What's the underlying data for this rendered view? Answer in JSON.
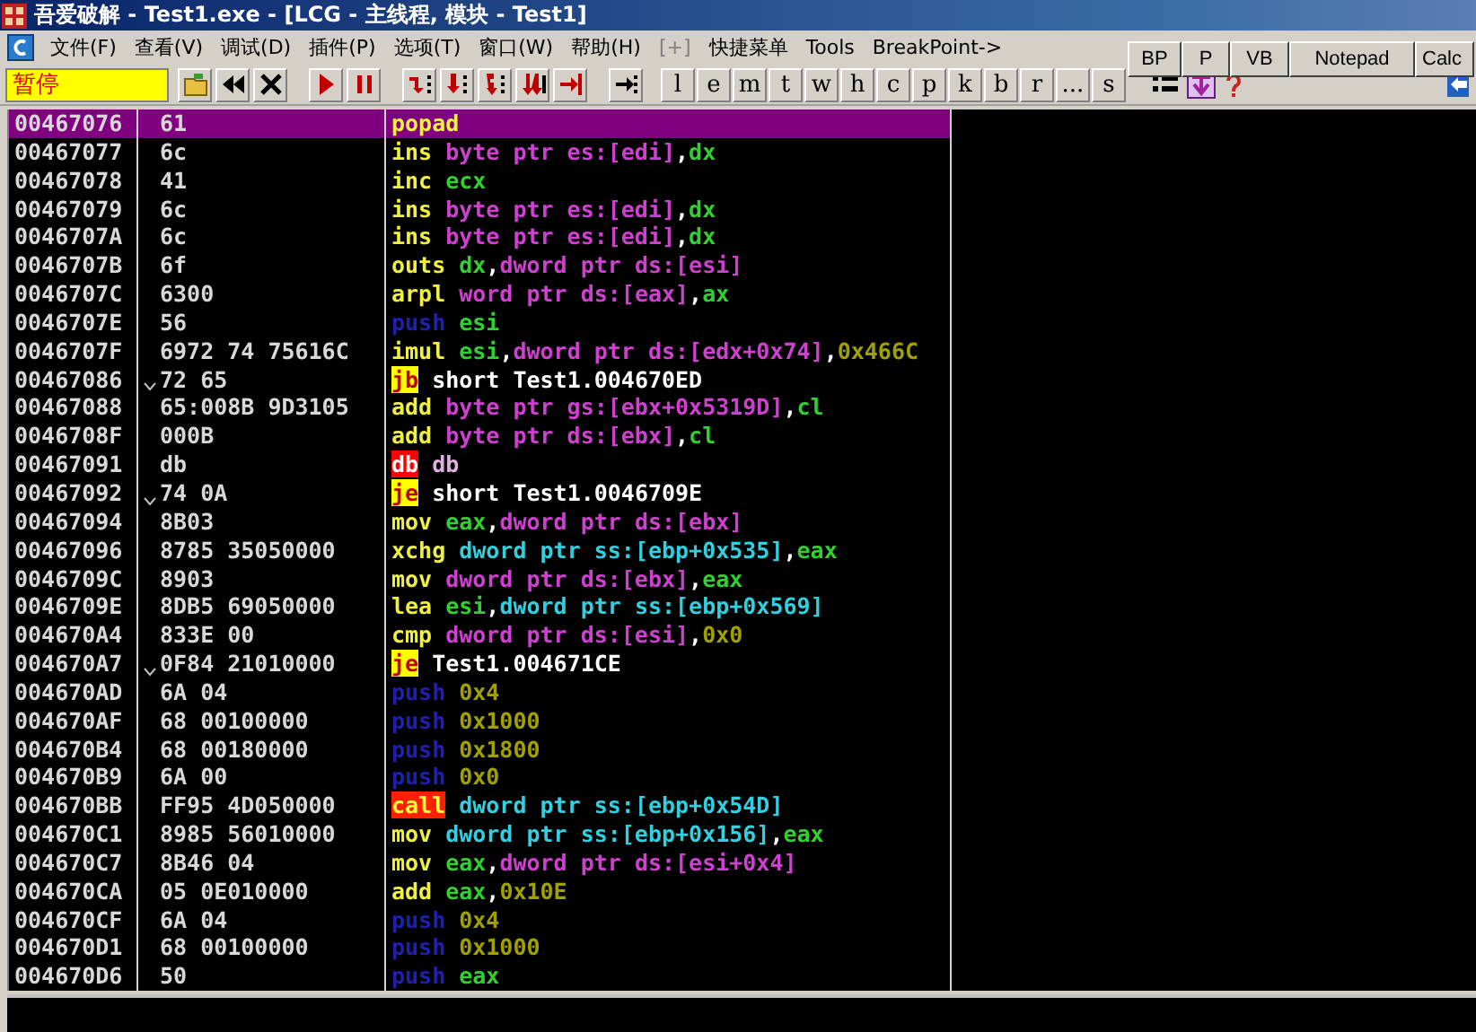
{
  "window": {
    "title": "吾爱破解 - Test1.exe - [LCG - 主线程, 模块 - Test1]"
  },
  "menu": [
    "文件(F)",
    "查看(V)",
    "调试(D)",
    "插件(P)",
    "选项(T)",
    "窗口(W)",
    "帮助(H)",
    "[+]",
    "快捷菜单",
    "Tools",
    "BreakPoint->"
  ],
  "quick_buttons": [
    "BP",
    "P",
    "VB",
    "Notepad",
    "Calc"
  ],
  "status_field": "暂停",
  "toolbar_letters": [
    "l",
    "e",
    "m",
    "t",
    "w",
    "h",
    "c",
    "p",
    "k",
    "b",
    "r",
    "...",
    "s"
  ],
  "rows": [
    {
      "address": "00467076",
      "hex": "61",
      "jump_arrow": false,
      "selected": true,
      "mnemonic": {
        "kind": "op",
        "text": "popad"
      },
      "operands": []
    },
    {
      "address": "00467077",
      "hex": "6c",
      "jump_arrow": false,
      "selected": false,
      "mnemonic": {
        "kind": "op",
        "text": "ins"
      },
      "operands": [
        {
          "kind": "mem",
          "text": "byte ptr es:[edi]"
        },
        {
          "kind": "plain",
          "text": ","
        },
        {
          "kind": "reg",
          "text": "dx"
        }
      ]
    },
    {
      "address": "00467078",
      "hex": "41",
      "jump_arrow": false,
      "selected": false,
      "mnemonic": {
        "kind": "op",
        "text": "inc"
      },
      "operands": [
        {
          "kind": "reg",
          "text": "ecx"
        }
      ]
    },
    {
      "address": "00467079",
      "hex": "6c",
      "jump_arrow": false,
      "selected": false,
      "mnemonic": {
        "kind": "op",
        "text": "ins"
      },
      "operands": [
        {
          "kind": "mem",
          "text": "byte ptr es:[edi]"
        },
        {
          "kind": "plain",
          "text": ","
        },
        {
          "kind": "reg",
          "text": "dx"
        }
      ]
    },
    {
      "address": "0046707A",
      "hex": "6c",
      "jump_arrow": false,
      "selected": false,
      "mnemonic": {
        "kind": "op",
        "text": "ins"
      },
      "operands": [
        {
          "kind": "mem",
          "text": "byte ptr es:[edi]"
        },
        {
          "kind": "plain",
          "text": ","
        },
        {
          "kind": "reg",
          "text": "dx"
        }
      ]
    },
    {
      "address": "0046707B",
      "hex": "6f",
      "jump_arrow": false,
      "selected": false,
      "mnemonic": {
        "kind": "op",
        "text": "outs"
      },
      "operands": [
        {
          "kind": "reg",
          "text": "dx"
        },
        {
          "kind": "plain",
          "text": ","
        },
        {
          "kind": "mem",
          "text": "dword ptr ds:[esi]"
        }
      ]
    },
    {
      "address": "0046707C",
      "hex": "6300",
      "jump_arrow": false,
      "selected": false,
      "mnemonic": {
        "kind": "op",
        "text": "arpl"
      },
      "operands": [
        {
          "kind": "mem",
          "text": "word ptr ds:[eax]"
        },
        {
          "kind": "plain",
          "text": ","
        },
        {
          "kind": "reg",
          "text": "ax"
        }
      ]
    },
    {
      "address": "0046707E",
      "hex": "56",
      "jump_arrow": false,
      "selected": false,
      "mnemonic": {
        "kind": "push",
        "text": "push"
      },
      "operands": [
        {
          "kind": "reg",
          "text": "esi"
        }
      ]
    },
    {
      "address": "0046707F",
      "hex": "6972 74 75616C",
      "jump_arrow": false,
      "selected": false,
      "mnemonic": {
        "kind": "op",
        "text": "imul"
      },
      "operands": [
        {
          "kind": "reg",
          "text": "esi"
        },
        {
          "kind": "plain",
          "text": ","
        },
        {
          "kind": "mem",
          "text": "dword ptr ds:[edx+0x74]"
        },
        {
          "kind": "plain",
          "text": ","
        },
        {
          "kind": "num",
          "text": "0x466C"
        }
      ]
    },
    {
      "address": "00467086",
      "hex": "72 65",
      "jump_arrow": true,
      "selected": false,
      "mnemonic": {
        "kind": "jump",
        "text": "jb"
      },
      "operands": [
        {
          "kind": "plain",
          "text": "short Test1.004670ED"
        }
      ]
    },
    {
      "address": "00467088",
      "hex": "65:008B 9D3105",
      "jump_arrow": false,
      "selected": false,
      "mnemonic": {
        "kind": "op",
        "text": "add"
      },
      "operands": [
        {
          "kind": "mem",
          "text": "byte ptr gs:[ebx+0x5319D]"
        },
        {
          "kind": "plain",
          "text": ","
        },
        {
          "kind": "reg",
          "text": "cl"
        }
      ]
    },
    {
      "address": "0046708F",
      "hex": "000B",
      "jump_arrow": false,
      "selected": false,
      "mnemonic": {
        "kind": "op",
        "text": "add"
      },
      "operands": [
        {
          "kind": "mem",
          "text": "byte ptr ds:[ebx]"
        },
        {
          "kind": "plain",
          "text": ","
        },
        {
          "kind": "reg",
          "text": "cl"
        }
      ]
    },
    {
      "address": "00467091",
      "hex": "db",
      "jump_arrow": false,
      "selected": false,
      "mnemonic": {
        "kind": "invalid",
        "text": "db"
      },
      "operands": [
        {
          "kind": "data",
          "text": "db"
        }
      ]
    },
    {
      "address": "00467092",
      "hex": "74 0A",
      "jump_arrow": true,
      "selected": false,
      "mnemonic": {
        "kind": "jump",
        "text": "je"
      },
      "operands": [
        {
          "kind": "plain",
          "text": "short Test1.0046709E"
        }
      ]
    },
    {
      "address": "00467094",
      "hex": "8B03",
      "jump_arrow": false,
      "selected": false,
      "mnemonic": {
        "kind": "op",
        "text": "mov"
      },
      "operands": [
        {
          "kind": "reg",
          "text": "eax"
        },
        {
          "kind": "plain",
          "text": ","
        },
        {
          "kind": "mem",
          "text": "dword ptr ds:[ebx]"
        }
      ]
    },
    {
      "address": "00467096",
      "hex": "8785 35050000",
      "jump_arrow": false,
      "selected": false,
      "mnemonic": {
        "kind": "op",
        "text": "xchg"
      },
      "operands": [
        {
          "kind": "stack",
          "text": "dword ptr ss:[ebp+0x535]"
        },
        {
          "kind": "plain",
          "text": ","
        },
        {
          "kind": "reg",
          "text": "eax"
        }
      ]
    },
    {
      "address": "0046709C",
      "hex": "8903",
      "jump_arrow": false,
      "selected": false,
      "mnemonic": {
        "kind": "op",
        "text": "mov"
      },
      "operands": [
        {
          "kind": "mem",
          "text": "dword ptr ds:[ebx]"
        },
        {
          "kind": "plain",
          "text": ","
        },
        {
          "kind": "reg",
          "text": "eax"
        }
      ]
    },
    {
      "address": "0046709E",
      "hex": "8DB5 69050000",
      "jump_arrow": false,
      "selected": false,
      "mnemonic": {
        "kind": "op",
        "text": "lea"
      },
      "operands": [
        {
          "kind": "reg",
          "text": "esi"
        },
        {
          "kind": "plain",
          "text": ","
        },
        {
          "kind": "stack",
          "text": "dword ptr ss:[ebp+0x569]"
        }
      ]
    },
    {
      "address": "004670A4",
      "hex": "833E 00",
      "jump_arrow": false,
      "selected": false,
      "mnemonic": {
        "kind": "op",
        "text": "cmp"
      },
      "operands": [
        {
          "kind": "mem",
          "text": "dword ptr ds:[esi]"
        },
        {
          "kind": "plain",
          "text": ","
        },
        {
          "kind": "num",
          "text": "0x0"
        }
      ]
    },
    {
      "address": "004670A7",
      "hex": "0F84 21010000",
      "jump_arrow": true,
      "selected": false,
      "mnemonic": {
        "kind": "jump",
        "text": "je"
      },
      "operands": [
        {
          "kind": "plain",
          "text": "Test1.004671CE"
        }
      ]
    },
    {
      "address": "004670AD",
      "hex": "6A 04",
      "jump_arrow": false,
      "selected": false,
      "mnemonic": {
        "kind": "push",
        "text": "push"
      },
      "operands": [
        {
          "kind": "num",
          "text": "0x4"
        }
      ]
    },
    {
      "address": "004670AF",
      "hex": "68 00100000",
      "jump_arrow": false,
      "selected": false,
      "mnemonic": {
        "kind": "push",
        "text": "push"
      },
      "operands": [
        {
          "kind": "num",
          "text": "0x1000"
        }
      ]
    },
    {
      "address": "004670B4",
      "hex": "68 00180000",
      "jump_arrow": false,
      "selected": false,
      "mnemonic": {
        "kind": "push",
        "text": "push"
      },
      "operands": [
        {
          "kind": "num",
          "text": "0x1800"
        }
      ]
    },
    {
      "address": "004670B9",
      "hex": "6A 00",
      "jump_arrow": false,
      "selected": false,
      "mnemonic": {
        "kind": "push",
        "text": "push"
      },
      "operands": [
        {
          "kind": "num",
          "text": "0x0"
        }
      ]
    },
    {
      "address": "004670BB",
      "hex": "FF95 4D050000",
      "jump_arrow": false,
      "selected": false,
      "mnemonic": {
        "kind": "call",
        "text": "call"
      },
      "operands": [
        {
          "kind": "stack",
          "text": "dword ptr ss:[ebp+0x54D]"
        }
      ]
    },
    {
      "address": "004670C1",
      "hex": "8985 56010000",
      "jump_arrow": false,
      "selected": false,
      "mnemonic": {
        "kind": "op",
        "text": "mov"
      },
      "operands": [
        {
          "kind": "stack",
          "text": "dword ptr ss:[ebp+0x156]"
        },
        {
          "kind": "plain",
          "text": ","
        },
        {
          "kind": "reg",
          "text": "eax"
        }
      ]
    },
    {
      "address": "004670C7",
      "hex": "8B46 04",
      "jump_arrow": false,
      "selected": false,
      "mnemonic": {
        "kind": "op",
        "text": "mov"
      },
      "operands": [
        {
          "kind": "reg",
          "text": "eax"
        },
        {
          "kind": "plain",
          "text": ","
        },
        {
          "kind": "mem",
          "text": "dword ptr ds:[esi+0x4]"
        }
      ]
    },
    {
      "address": "004670CA",
      "hex": "05 0E010000",
      "jump_arrow": false,
      "selected": false,
      "mnemonic": {
        "kind": "op",
        "text": "add"
      },
      "operands": [
        {
          "kind": "reg",
          "text": "eax"
        },
        {
          "kind": "plain",
          "text": ","
        },
        {
          "kind": "num",
          "text": "0x10E"
        }
      ]
    },
    {
      "address": "004670CF",
      "hex": "6A 04",
      "jump_arrow": false,
      "selected": false,
      "mnemonic": {
        "kind": "push",
        "text": "push"
      },
      "operands": [
        {
          "kind": "num",
          "text": "0x4"
        }
      ]
    },
    {
      "address": "004670D1",
      "hex": "68 00100000",
      "jump_arrow": false,
      "selected": false,
      "mnemonic": {
        "kind": "push",
        "text": "push"
      },
      "operands": [
        {
          "kind": "num",
          "text": "0x1000"
        }
      ]
    },
    {
      "address": "004670D6",
      "hex": "50",
      "jump_arrow": false,
      "selected": false,
      "mnemonic": {
        "kind": "push",
        "text": "push"
      },
      "operands": [
        {
          "kind": "reg",
          "text": "eax"
        }
      ]
    }
  ]
}
